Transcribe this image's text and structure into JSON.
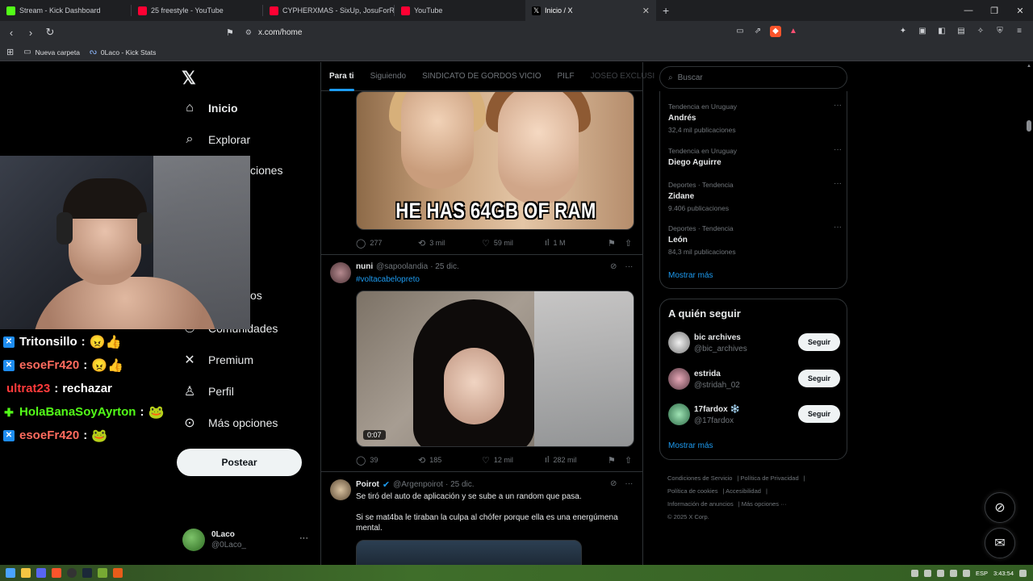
{
  "browser": {
    "tabs": [
      {
        "label": "Stream - Kick Dashboard",
        "color": "#53fc18"
      },
      {
        "label": "25 freestyle - YouTube",
        "color": "#ff0033"
      },
      {
        "label": "CYPHERXMAS - SixUp, JosuForReal, F",
        "color": "#ff0033"
      },
      {
        "label": "YouTube",
        "color": "#ff0033"
      },
      {
        "label": "Inicio / X",
        "color": "#ffffff"
      }
    ],
    "url": "x.com/home",
    "bookmarks": [
      "Nueva carpeta",
      "0Laco - Kick Stats"
    ]
  },
  "nav": {
    "items": [
      "Inicio",
      "Explorar",
      "Notificaciones",
      "Comunidades",
      "Premium",
      "Perfil",
      "Más opciones"
    ],
    "visible_partial": {
      "notificaciones": "ciones",
      "guardados": "os"
    },
    "post_label": "Postear",
    "account": {
      "name": "0Laco",
      "handle": "@0Laco_"
    }
  },
  "chat": [
    {
      "user": "Tritonsillo",
      "color": "#ffffff",
      "badge": "blue",
      "emote": "😠👍"
    },
    {
      "user": "esoeFr420",
      "color": "#ff6b5e",
      "badge": "blue",
      "emote": "😠👍"
    },
    {
      "user": "ultrat23",
      "color": "#ff3b3b",
      "badge": "",
      "msg": "rechazar"
    },
    {
      "user": "HolaBanaSoyAyrton",
      "color": "#53fc18",
      "badge": "green",
      "emote": "🐸"
    },
    {
      "user": "esoeFr420",
      "color": "#ff6b5e",
      "badge": "blue",
      "emote": "🐸"
    }
  ],
  "feed": {
    "tabs": [
      "Para ti",
      "Siguiendo",
      "SINDICATO DE GORDOS VICIO",
      "PILF",
      "JOSEO EXCLUSI"
    ],
    "meme_caption": "HE HAS 64GB OF RAM",
    "post1_stats": {
      "replies": "277",
      "reposts": "3 mil",
      "likes": "59 mil",
      "views": "1 M"
    },
    "post2": {
      "name": "nuni",
      "handle": "@sapoolandia",
      "date": "· 25 dic.",
      "hashtag": "#voltacabelopreto",
      "duration": "0:07"
    },
    "post2_stats": {
      "replies": "39",
      "reposts": "185",
      "likes": "12 mil",
      "views": "282 mil"
    },
    "post3": {
      "name": "Poirot",
      "handle": "@Argenpoirot",
      "date": "· 25 dic.",
      "line1": "Se tiró del auto de aplicación y se sube a un random que pasa.",
      "line2": "Si se mat4ba le tiraban la culpa al chófer porque ella es una energúmena mental."
    }
  },
  "sidebar": {
    "search_placeholder": "Buscar",
    "trends": [
      {
        "context": "Tendencia en Uruguay",
        "title": "Andrés",
        "count": "32,4 mil publicaciones"
      },
      {
        "context": "Tendencia en Uruguay",
        "title": "Diego Aguirre",
        "count": ""
      },
      {
        "context": "Deportes · Tendencia",
        "title": "Zidane",
        "count": "9.406 publicaciones"
      },
      {
        "context": "Deportes · Tendencia",
        "title": "León",
        "count": "84,3 mil publicaciones"
      }
    ],
    "show_more": "Mostrar más",
    "who_to_follow_title": "A quién seguir",
    "follow": [
      {
        "name": "bic archives",
        "handle": "@bic_archives",
        "button": "Seguir"
      },
      {
        "name": "estrida",
        "handle": "@stridah_02",
        "button": "Seguir"
      },
      {
        "name": "17fardox ❄️",
        "handle": "@17fardox",
        "button": "Seguir"
      }
    ],
    "show_more2": "Mostrar más",
    "footer": {
      "l1": "Condiciones de Servicio",
      "l2": "Política de Privacidad",
      "l3": "Política de cookies",
      "l4": "Accesibilidad",
      "l5": "Información de anuncios",
      "l6": "Más opciones ···",
      "copy": "© 2025 X Corp."
    }
  },
  "taskbar": {
    "lang": "ESP",
    "time": "3:43:54"
  }
}
